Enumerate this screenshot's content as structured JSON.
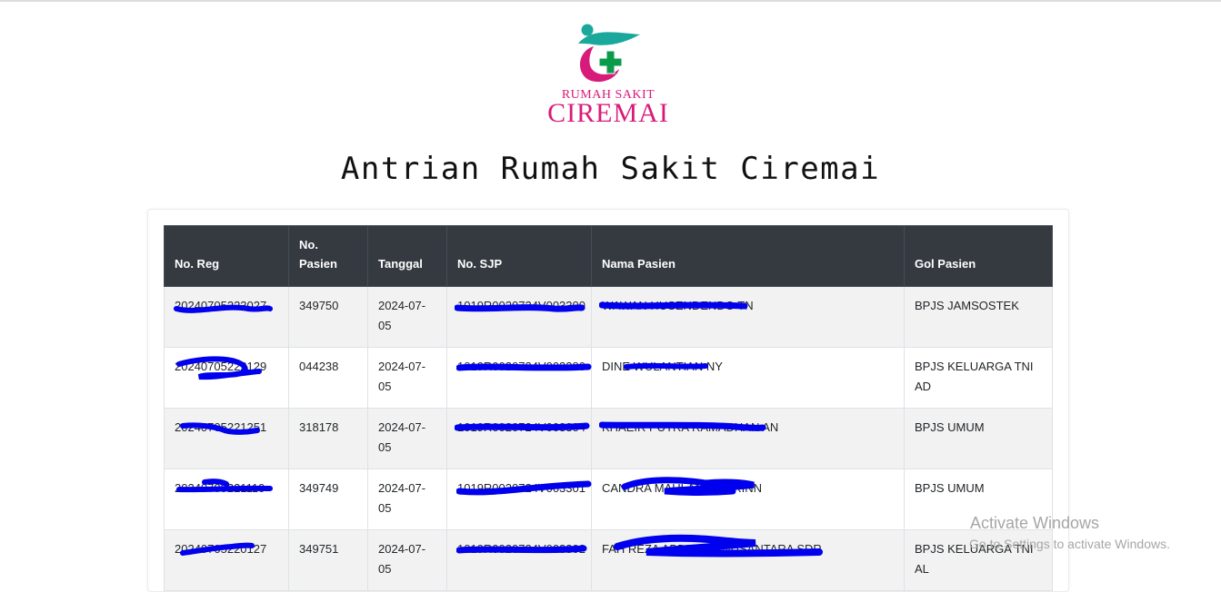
{
  "logo": {
    "line1": "RUMAH SAKIT",
    "line2": "CIREMAI",
    "colors": {
      "teal": "#1aa89c",
      "magenta": "#d81b7a",
      "green": "#0a9b4a"
    }
  },
  "page_title": "Antrian Rumah Sakit Ciremai",
  "table": {
    "columns": [
      "No. Reg",
      "No. Pasien",
      "Tanggal",
      "No. SJP",
      "Nama Pasien",
      "Gol Pasien"
    ],
    "rows": [
      {
        "no_reg": "20240705223027",
        "no_pasien": "349750",
        "tanggal": "2024-07-05",
        "no_sjp": "1019R0020724V003300",
        "nama": "WAWAN HUSENDENDO TN",
        "gol": "BPJS JAMSOSTEK"
      },
      {
        "no_reg": "20240705222129",
        "no_pasien": "044238",
        "tanggal": "2024-07-05",
        "no_sjp": "1019R0020724V003380",
        "nama": "DINE WULANTIAN NY",
        "gol": "BPJS KELUARGA TNI AD"
      },
      {
        "no_reg": "20240705221251",
        "no_pasien": "318178",
        "tanggal": "2024-07-05",
        "no_sjp": "1019R0020724V003304",
        "nama": "KHAEIR PUTRA RAMADHAN AN",
        "gol": "BPJS UMUM"
      },
      {
        "no_reg": "20240705221110",
        "no_pasien": "349749",
        "tanggal": "2024-07-05",
        "no_sjp": "1019R0020724V003301",
        "nama": "CANDRA MAULANA TN RINN",
        "gol": "BPJS UMUM"
      },
      {
        "no_reg": "20240705220127",
        "no_pasien": "349751",
        "tanggal": "2024-07-05",
        "no_sjp": "1019R0020724V003302",
        "nama": "FAH REZA ABDILLAH NUSANTARA SDR",
        "gol": "BPJS KELUARGA TNI AL"
      }
    ]
  },
  "redaction_color": "#0000ee",
  "watermark": {
    "line1": "Activate Windows",
    "line2": "Go to Settings to activate Windows."
  }
}
